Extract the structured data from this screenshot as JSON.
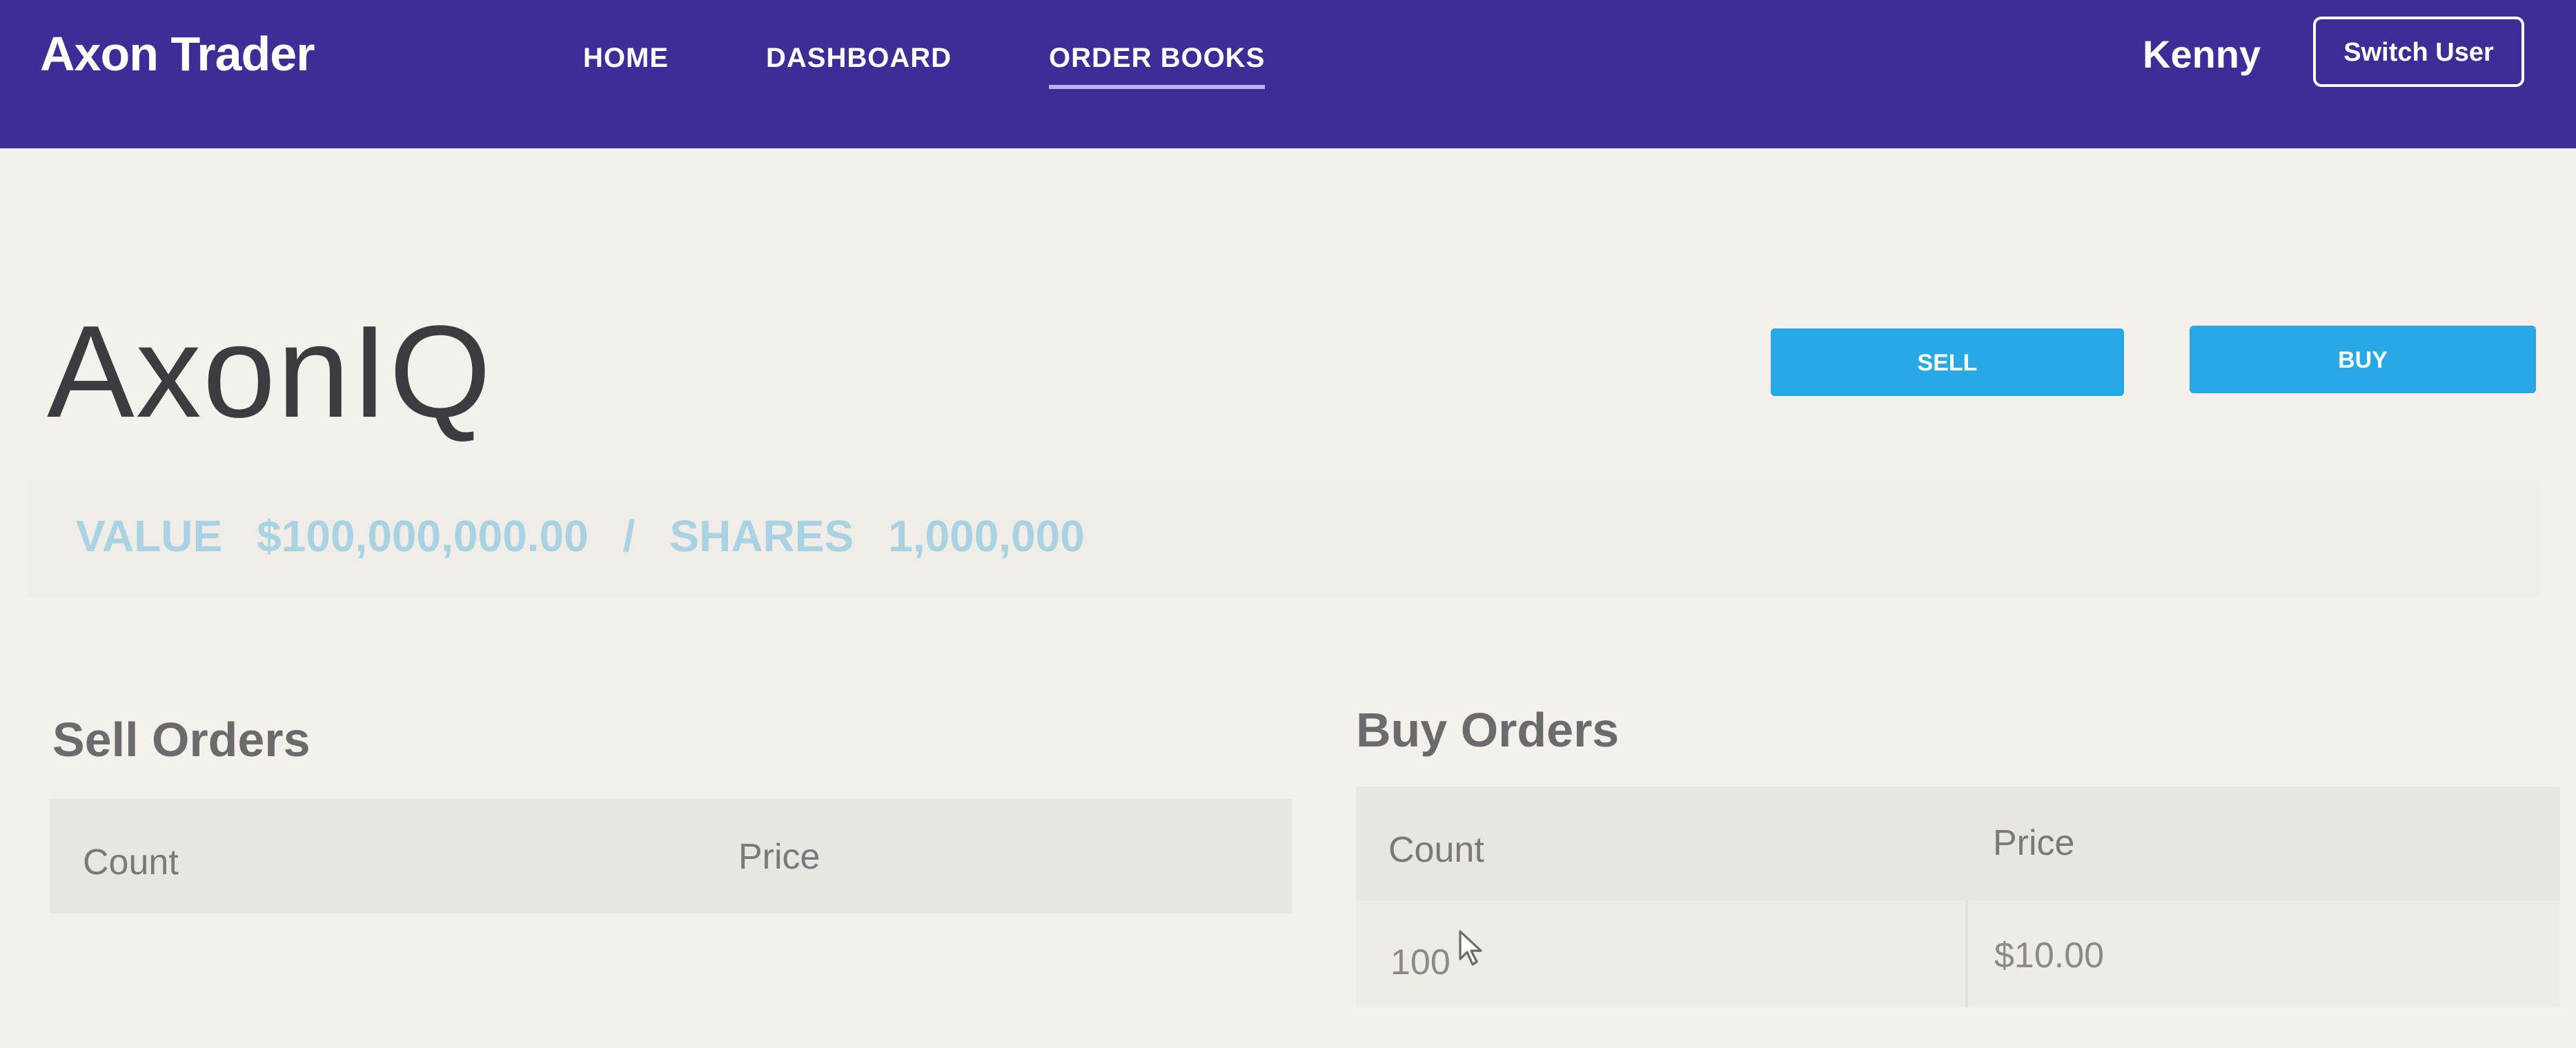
{
  "header": {
    "brand": "Axon Trader",
    "nav": [
      {
        "label": "HOME"
      },
      {
        "label": "DASHBOARD"
      },
      {
        "label": "ORDER BOOKS",
        "active": true
      }
    ],
    "user_name": "Kenny",
    "switch_user_label": "Switch User"
  },
  "company": {
    "name": "AxonIQ",
    "sell_label": "SELL",
    "buy_label": "BUY",
    "value_label": "VALUE",
    "value": "$100,000,000.00",
    "separator": "/",
    "shares_label": "SHARES",
    "shares": "1,000,000"
  },
  "sell_orders": {
    "title": "Sell Orders",
    "columns": [
      "Count",
      "Price"
    ],
    "rows": []
  },
  "buy_orders": {
    "title": "Buy Orders",
    "columns": [
      "Count",
      "Price"
    ],
    "rows": [
      {
        "count": "100",
        "price": "$10.00"
      }
    ]
  },
  "colors": {
    "navbar": "#3f2d97",
    "button": "#29a8e6",
    "stats_text": "#a9d3e3"
  },
  "icons": {
    "cursor": "mouse-pointer-icon"
  }
}
